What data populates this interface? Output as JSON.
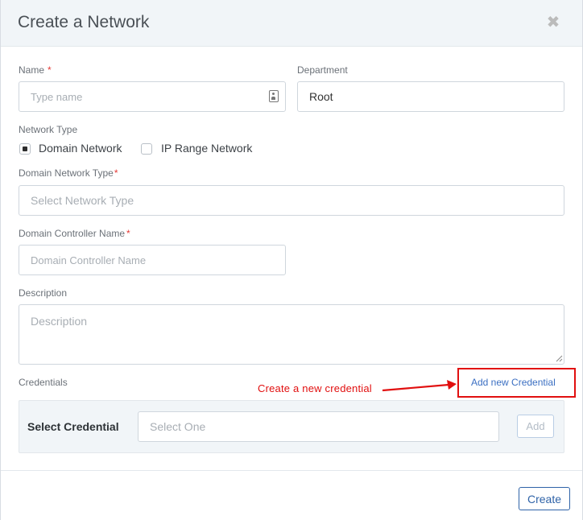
{
  "header": {
    "title": "Create a Network",
    "close_glyph": "✖",
    "close_icon": "close-icon"
  },
  "form": {
    "name": {
      "label": "Name",
      "required_mark": "*",
      "placeholder": "Type name",
      "value": "",
      "icon": "id-card-icon"
    },
    "department": {
      "label": "Department",
      "value": "Root"
    },
    "network_type": {
      "label": "Network Type",
      "options": [
        {
          "label": "Domain Network",
          "checked": true
        },
        {
          "label": "IP Range Network",
          "checked": false
        }
      ]
    },
    "domain_network_type": {
      "label": "Domain Network Type",
      "required_mark": "*",
      "placeholder": "Select Network Type"
    },
    "domain_controller_name": {
      "label": "Domain Controller Name",
      "required_mark": "*",
      "placeholder": "Domain Controller Name"
    },
    "description": {
      "label": "Description",
      "placeholder": "Description"
    },
    "credentials": {
      "label": "Credentials",
      "add_link": "Add new Credential",
      "select_label": "Select Credential",
      "select_placeholder": "Select One",
      "add_button": "Add"
    }
  },
  "annotation": {
    "text": "Create a new credential",
    "color": "#e10f0f"
  },
  "footer": {
    "create_button": "Create"
  },
  "colors": {
    "header_bg": "#f1f5f8",
    "link": "#3b6fc2",
    "primary_border": "#2f63a8",
    "required": "#e53935"
  }
}
